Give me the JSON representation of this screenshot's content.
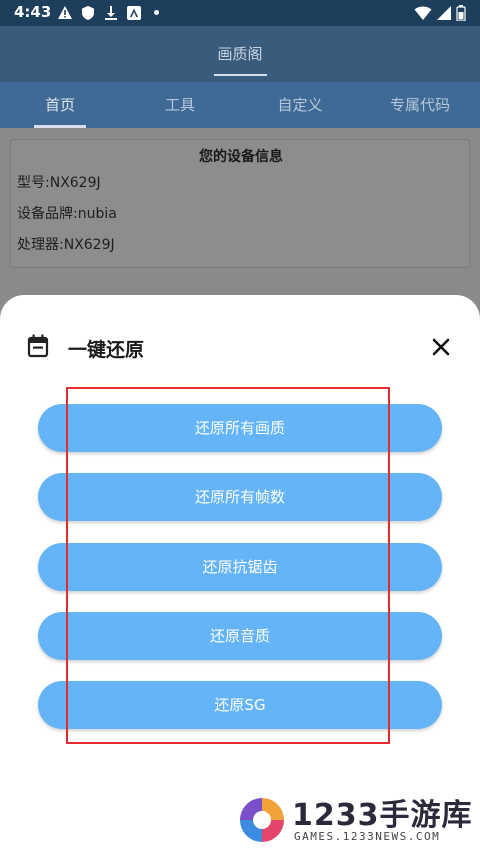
{
  "status_bar": {
    "time": "4:43"
  },
  "app_bar": {
    "title": "画质阁"
  },
  "tabs": [
    {
      "label": "首页"
    },
    {
      "label": "工具"
    },
    {
      "label": "自定义"
    },
    {
      "label": "专属代码"
    }
  ],
  "device_card": {
    "title": "您的设备信息",
    "model": "型号:NX629J",
    "brand": "设备品牌:nubia",
    "processor": "处理器:NX629J"
  },
  "sheet": {
    "title": "一键还原",
    "buttons": [
      {
        "label": "还原所有画质"
      },
      {
        "label": "还原所有帧数"
      },
      {
        "label": "还原抗锯齿"
      },
      {
        "label": "还原音质"
      },
      {
        "label": "还原SG"
      }
    ]
  },
  "watermark": {
    "brand": "1233手游库",
    "site": "GAMES.1233NEWS.COM"
  },
  "colors": {
    "button_bg": "#64b4f7",
    "appbar": "#3a5c7c",
    "tabs_bg": "#3f6a96",
    "highlight_border": "#e52b2b"
  }
}
